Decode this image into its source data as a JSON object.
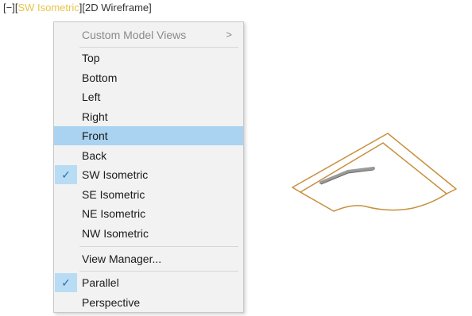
{
  "view_controls": {
    "minus": "[−]",
    "view_open": "[",
    "view": "SW Isometric",
    "view_close": "]",
    "style": "[2D Wireframe]"
  },
  "menu": {
    "custom_model_views": "Custom Model Views",
    "submenu_arrow": ">",
    "top": "Top",
    "bottom": "Bottom",
    "left": "Left",
    "right": "Right",
    "front": "Front",
    "back": "Back",
    "sw_isometric": "SW Isometric",
    "se_isometric": "SE Isometric",
    "ne_isometric": "NE Isometric",
    "nw_isometric": "NW Isometric",
    "view_manager": "View Manager...",
    "parallel": "Parallel",
    "perspective": "Perspective",
    "check": "✓"
  },
  "colors": {
    "highlight": "#a9d3f0",
    "active_view": "#e8c34a",
    "model_stroke": "#c8903c"
  },
  "icons": {
    "check": "checkmark-icon",
    "submenu": "chevron-right-icon"
  }
}
